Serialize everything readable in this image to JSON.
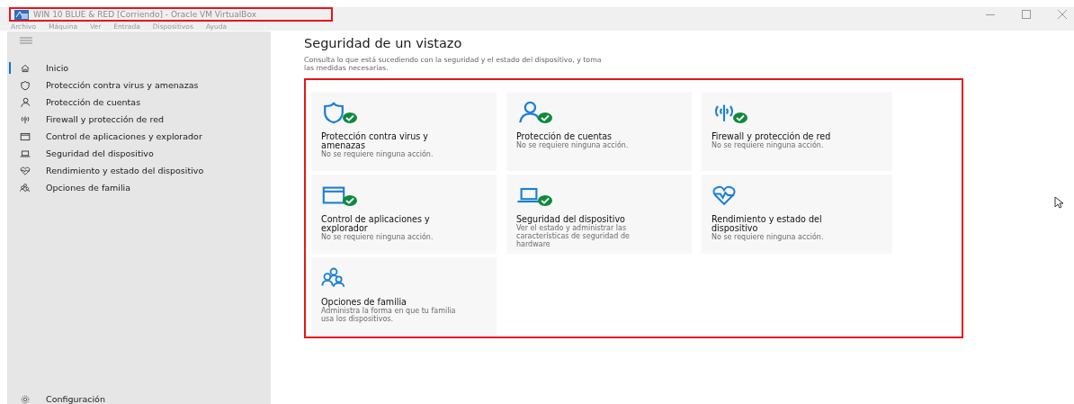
{
  "window": {
    "title": "WIN 10 BLUE & RED [Corriendo] - Oracle VM VirtualBox"
  },
  "menu": [
    "Archivo",
    "Máquina",
    "Ver",
    "Entrada",
    "Dispositivos",
    "Ayuda"
  ],
  "sidebar": {
    "items": [
      {
        "kind": "home",
        "label": "Inicio",
        "selected": true
      },
      {
        "kind": "shield",
        "label": "Protección contra virus y amenazas",
        "selected": false
      },
      {
        "kind": "person",
        "label": "Protección de cuentas",
        "selected": false
      },
      {
        "kind": "wifi",
        "label": "Firewall y protección de red",
        "selected": false
      },
      {
        "kind": "browser",
        "label": "Control de aplicaciones y explorador",
        "selected": false
      },
      {
        "kind": "laptop",
        "label": "Seguridad del dispositivo",
        "selected": false
      },
      {
        "kind": "heart",
        "label": "Rendimiento y estado del dispositivo",
        "selected": false
      },
      {
        "kind": "family",
        "label": "Opciones de familia",
        "selected": false
      }
    ],
    "footer": {
      "kind": "gear",
      "label": "Configuración"
    }
  },
  "main": {
    "title": "Seguridad de un vistazo",
    "description": "Consulta lo que está sucediendo con la seguridad y el estado del dispositivo, y toma las medidas necesarias.",
    "tiles": [
      {
        "kind": "shield",
        "title": "Protección contra virus y amenazas",
        "status": "No se requiere ninguna acción.",
        "ok": true
      },
      {
        "kind": "person",
        "title": "Protección de cuentas",
        "status": "No se requiere ninguna acción.",
        "ok": true
      },
      {
        "kind": "wifi",
        "title": "Firewall y protección de red",
        "status": "No se requiere ninguna acción.",
        "ok": true
      },
      {
        "kind": "browser",
        "title": "Control de aplicaciones y explorador",
        "status": "No se requiere ninguna acción.",
        "ok": true
      },
      {
        "kind": "laptop",
        "title": "Seguridad del dispositivo",
        "status": "Ver el estado y administrar las características de seguridad de hardware",
        "ok": true
      },
      {
        "kind": "heart",
        "title": "Rendimiento y estado del dispositivo",
        "status": "No se requiere ninguna acción.",
        "ok": false
      },
      {
        "kind": "family",
        "title": "Opciones de familia",
        "status": "Administra la forma en que tu familia usa los dispositivos.",
        "ok": false
      }
    ]
  }
}
